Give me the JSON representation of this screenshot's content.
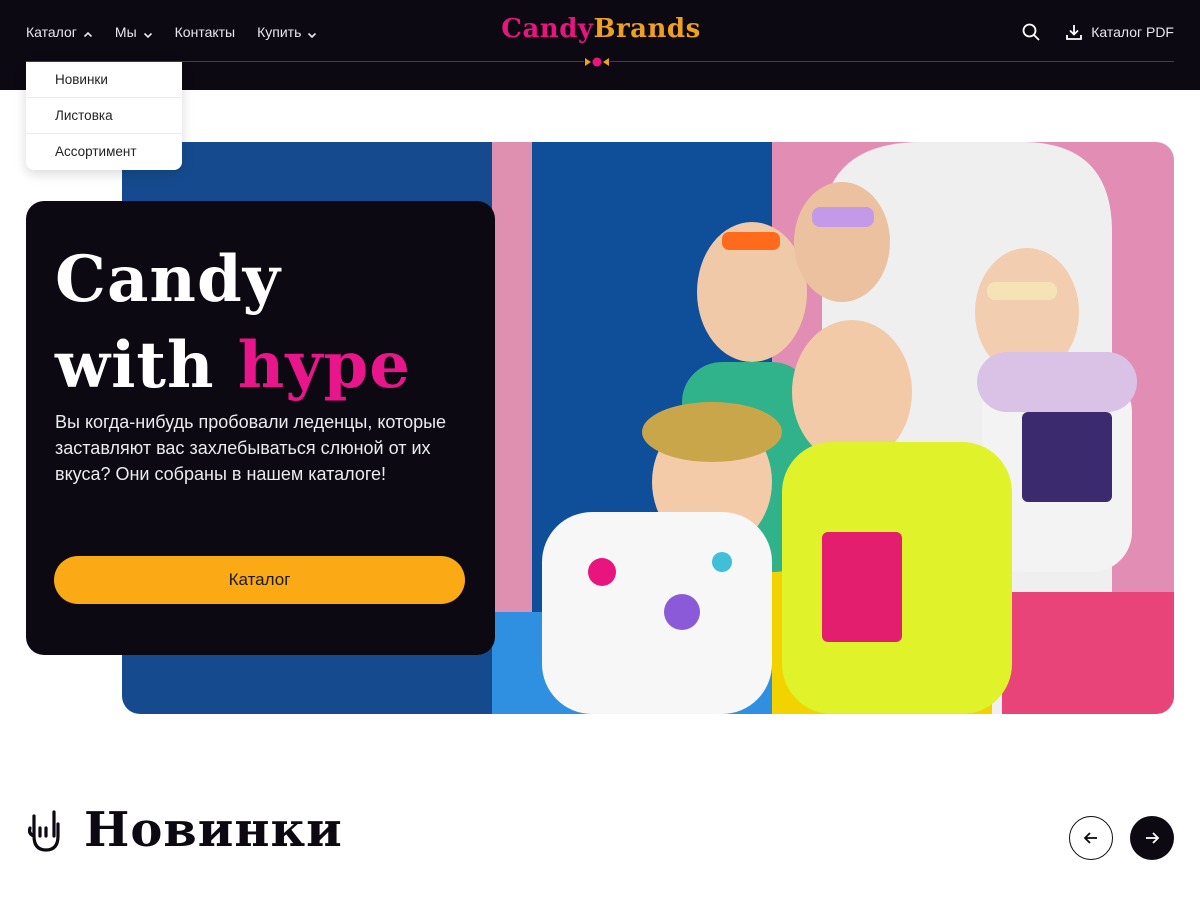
{
  "header": {
    "nav": [
      {
        "label": "Каталог",
        "icon": "chevron-up-icon"
      },
      {
        "label": "Мы",
        "icon": "chevron-down-icon"
      },
      {
        "label": "Контакты"
      },
      {
        "label": "Купить",
        "icon": "chevron-down-icon"
      }
    ],
    "logo_part1": "Candy",
    "logo_part2": "B",
    "logo_part3": "rands",
    "pdf_label": "Каталог PDF"
  },
  "dropdown": {
    "items": [
      "Новинки",
      "Листовка",
      "Ассортимент"
    ]
  },
  "hero": {
    "title_line1": "Candy",
    "title_line2_word": "with ",
    "title_line2_accent": "hype",
    "text": "Вы когда-нибудь пробовали леденцы, которые заставляют вас захлебываться слюной от их вкуса? Они собраны в нашем каталоге!",
    "button_label": "Каталог"
  },
  "section": {
    "title": "Новинки"
  },
  "colors": {
    "dark": "#0c0912",
    "brand_orange": "#f0a020",
    "brand_pink": "#e8157f",
    "button_yellow": "#fba915"
  }
}
